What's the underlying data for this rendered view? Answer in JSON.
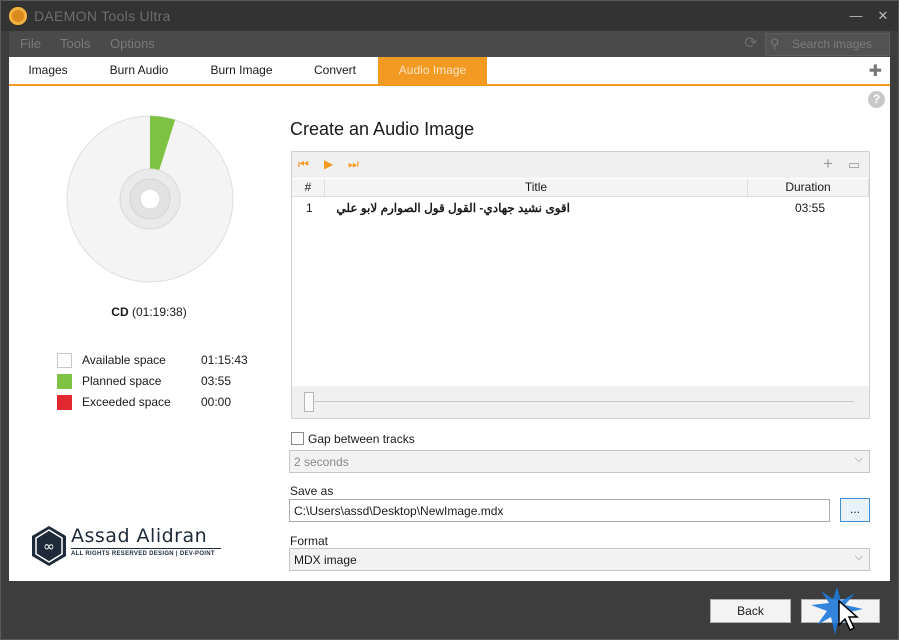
{
  "window": {
    "title": "DAEMON Tools Ultra",
    "minimize": "—",
    "close": "✕"
  },
  "menu": {
    "items": [
      "File",
      "Tools",
      "Options"
    ],
    "search_placeholder": "Search images"
  },
  "tabs": [
    {
      "label": "Images"
    },
    {
      "label": "Burn Audio"
    },
    {
      "label": "Burn Image"
    },
    {
      "label": "Convert"
    },
    {
      "label": "Audio Image",
      "active": true
    }
  ],
  "disc": {
    "type": "CD",
    "capacity": "(01:19:38)",
    "planned_fraction": 0.049
  },
  "legend": [
    {
      "label": "Available space",
      "value": "01:15:43",
      "color": "#ffffff"
    },
    {
      "label": "Planned space",
      "value": "03:55",
      "color": "#7dc242"
    },
    {
      "label": "Exceeded space",
      "value": "00:00",
      "color": "#e0282e"
    }
  ],
  "watermark": {
    "name": "Assad Alidran",
    "tagline": "ALL RIGHTS RESERVED DESIGN | DEV-POINT"
  },
  "main": {
    "heading": "Create an Audio Image",
    "columns": {
      "num": "#",
      "title": "Title",
      "duration": "Duration"
    },
    "tracks": [
      {
        "num": "1",
        "title": "اقوى نشيد جهادي- القول قول الصوارم لابو علي",
        "duration": "03:55"
      }
    ],
    "gap_label": "Gap between tracks",
    "gap_value": "2 seconds",
    "save_as_label": "Save as",
    "save_as_value": "C:\\Users\\assd\\Desktop\\NewImage.mdx",
    "browse_label": "...",
    "format_label": "Format",
    "format_value": "MDX image"
  },
  "footer": {
    "back": "Back",
    "next": ""
  },
  "colors": {
    "accent": "#f39a23",
    "planned": "#7dc242",
    "exceeded": "#e0282e"
  }
}
